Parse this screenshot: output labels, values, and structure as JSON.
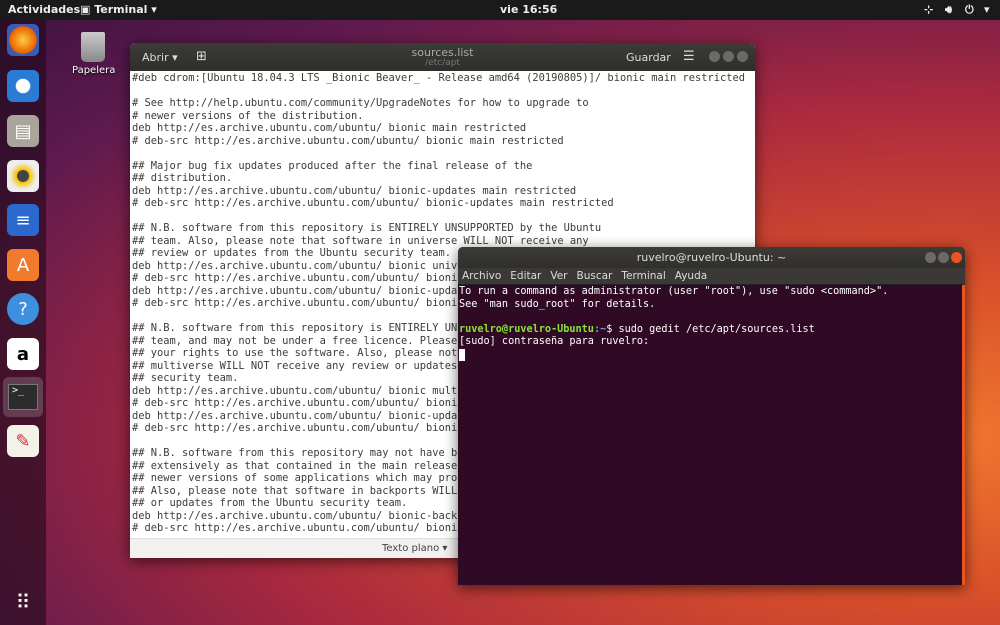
{
  "topbar": {
    "activities": "Actividades",
    "app": "Terminal",
    "clock": "vie 16:56",
    "icons": [
      "network-icon",
      "volume-icon",
      "power-icon",
      "chevron-down-icon"
    ]
  },
  "dock": {
    "items": [
      "firefox-icon",
      "thunderbird-icon",
      "files-icon",
      "rhythmbox-icon",
      "libreoffice-writer-icon",
      "software-center-icon",
      "help-icon",
      "amazon-icon",
      "terminal-icon",
      "text-editor-icon"
    ],
    "apps_grid": "show-applications-icon"
  },
  "desktop": {
    "trash_label": "Papelera"
  },
  "gedit": {
    "open_label": "Abrir",
    "title": "sources.list",
    "subtitle": "/etc/apt",
    "save_label": "Guardar",
    "status_syntax": "Texto plano",
    "lines": [
      "#deb cdrom:[Ubuntu 18.04.3 LTS _Bionic Beaver_ - Release amd64 (20190805)]/ bionic main restricted",
      "",
      "# See http://help.ubuntu.com/community/UpgradeNotes for how to upgrade to",
      "# newer versions of the distribution.",
      "deb http://es.archive.ubuntu.com/ubuntu/ bionic main restricted",
      "# deb-src http://es.archive.ubuntu.com/ubuntu/ bionic main restricted",
      "",
      "## Major bug fix updates produced after the final release of the",
      "## distribution.",
      "deb http://es.archive.ubuntu.com/ubuntu/ bionic-updates main restricted",
      "# deb-src http://es.archive.ubuntu.com/ubuntu/ bionic-updates main restricted",
      "",
      "## N.B. software from this repository is ENTIRELY UNSUPPORTED by the Ubuntu",
      "## team. Also, please note that software in universe WILL NOT receive any",
      "## review or updates from the Ubuntu security team.",
      "deb http://es.archive.ubuntu.com/ubuntu/ bionic univ",
      "# deb-src http://es.archive.ubuntu.com/ubuntu/ bioni",
      "deb http://es.archive.ubuntu.com/ubuntu/ bionic-upda",
      "# deb-src http://es.archive.ubuntu.com/ubuntu/ bioni",
      "",
      "## N.B. software from this repository is ENTIRELY UN",
      "## team, and may not be under a free licence. Please",
      "## your rights to use the software. Also, please not",
      "## multiverse WILL NOT receive any review or updates",
      "## security team.",
      "deb http://es.archive.ubuntu.com/ubuntu/ bionic mult",
      "# deb-src http://es.archive.ubuntu.com/ubuntu/ bioni",
      "deb http://es.archive.ubuntu.com/ubuntu/ bionic-upda",
      "# deb-src http://es.archive.ubuntu.com/ubuntu/ bioni",
      "",
      "## N.B. software from this repository may not have b",
      "## extensively as that contained in the main release",
      "## newer versions of some applications which may pro",
      "## Also, please note that software in backports WILL",
      "## or updates from the Ubuntu security team.",
      "deb http://es.archive.ubuntu.com/ubuntu/ bionic-back",
      "# deb-src http://es.archive.ubuntu.com/ubuntu/ bioni"
    ]
  },
  "terminal": {
    "title": "ruvelro@ruvelro-Ubuntu: ~",
    "menu": [
      "Archivo",
      "Editar",
      "Ver",
      "Buscar",
      "Terminal",
      "Ayuda"
    ],
    "line1": "To run a command as administrator (user \"root\"), use \"sudo <command>\".",
    "line2": "See \"man sudo_root\" for details.",
    "prompt_user": "ruvelro@ruvelro-Ubuntu",
    "prompt_path": ":~",
    "prompt_cmd": "$ sudo gedit /etc/apt/sources.list",
    "line4": "[sudo] contraseña para ruvelro:"
  },
  "colors": {
    "accent": "#e95420",
    "terminal_bg": "#300a24",
    "prompt_green": "#8ae234"
  }
}
